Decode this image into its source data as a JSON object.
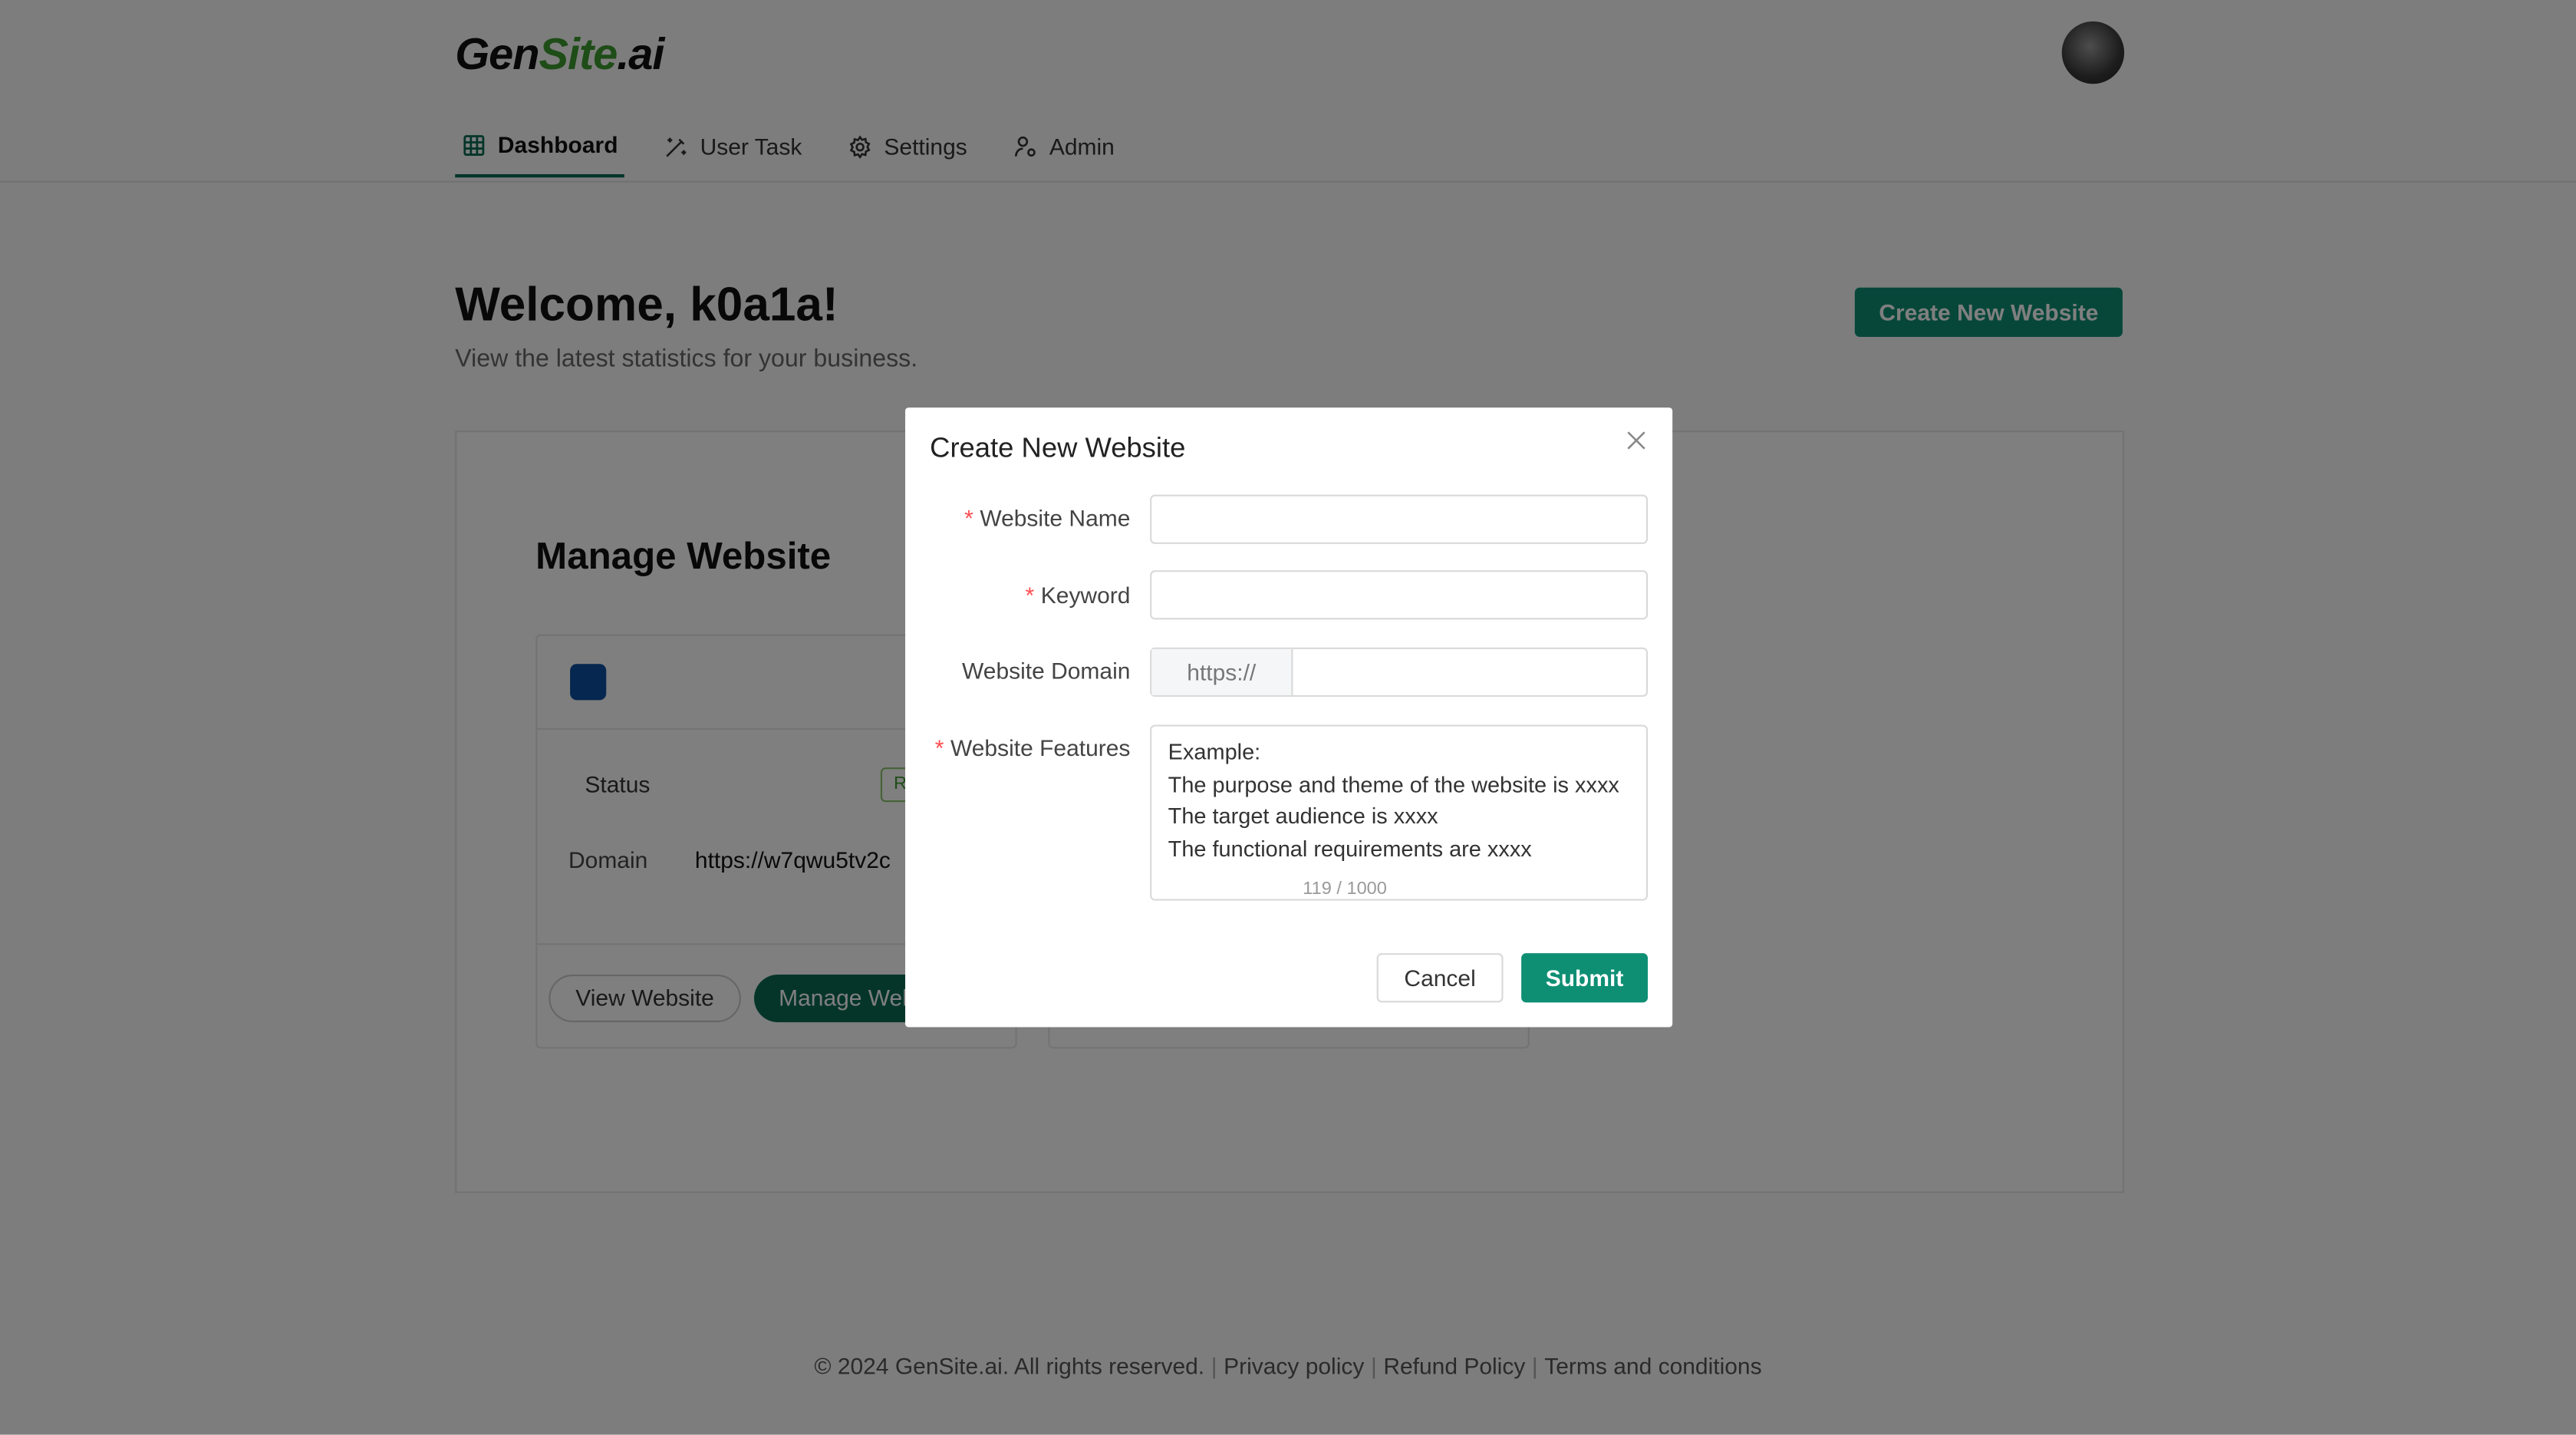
{
  "header": {
    "logo": {
      "part1": "Gen",
      "part2": "Site",
      "part3": ".ai"
    },
    "nav": [
      {
        "label": "Dashboard",
        "icon": "grid-icon",
        "active": true
      },
      {
        "label": "User Task",
        "icon": "magic-wand-icon",
        "active": false
      },
      {
        "label": "Settings",
        "icon": "gear-icon",
        "active": false
      },
      {
        "label": "Admin",
        "icon": "user-cog-icon",
        "active": false
      }
    ]
  },
  "main": {
    "welcome": "Welcome, k0a1a!",
    "subtitle": "View the latest statistics for your business.",
    "create_button": "Create New Website",
    "section_title": "Manage Website",
    "card": {
      "status_label": "Status",
      "status_badge": "R",
      "domain_label": "Domain",
      "domain_value": "https://w7qwu5tv2c",
      "view_button": "View Website",
      "manage_button": "Manage Website"
    }
  },
  "footer": {
    "copyright": "© 2024 GenSite.ai. All rights reserved.",
    "links": [
      "Privacy policy",
      "Refund Policy",
      "Terms and conditions"
    ]
  },
  "modal": {
    "title": "Create New Website",
    "fields": {
      "name_label": "Website Name",
      "name_value": "",
      "keyword_label": "Keyword",
      "keyword_value": "",
      "domain_label": "Website Domain",
      "domain_prefix": "https://",
      "domain_value": "",
      "features_label": "Website Features",
      "features_lines": [
        "Example:",
        "The purpose and theme of the website is xxxx",
        "The target audience is xxxx",
        "The functional requirements are xxxx"
      ],
      "features_count": "119 / 1000"
    },
    "cancel": "Cancel",
    "submit": "Submit"
  },
  "colors": {
    "accent": "#0e8f74",
    "nav_underline": "#0a6b52",
    "logo_green": "#3c9a2f",
    "required": "#ff4d4f"
  }
}
